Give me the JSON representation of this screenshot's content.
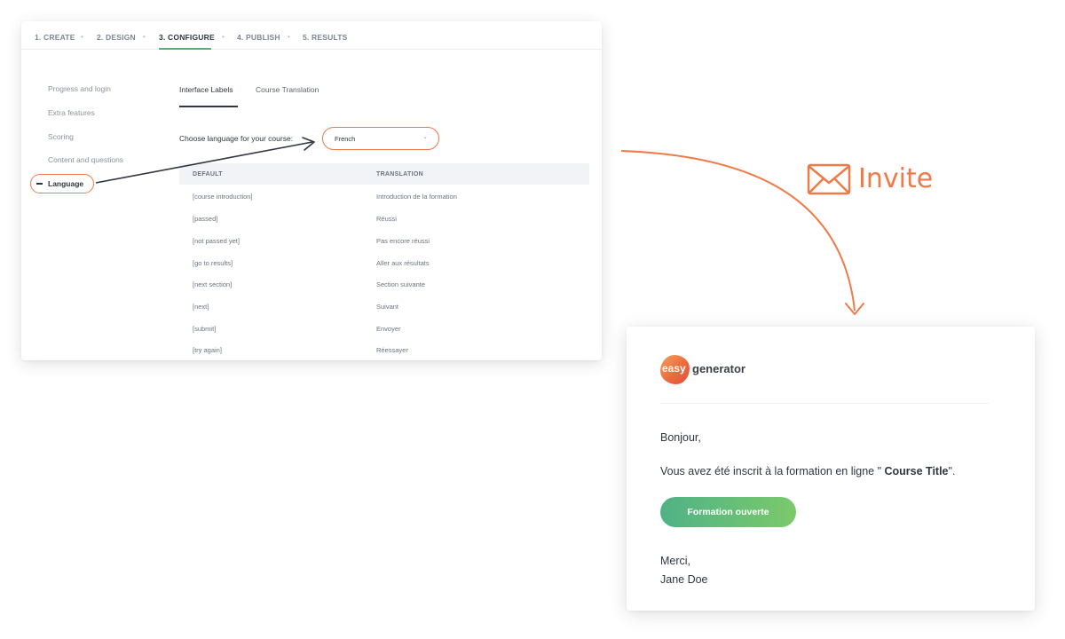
{
  "stepper": {
    "steps": [
      {
        "label": "1. CREATE"
      },
      {
        "label": "2. DESIGN"
      },
      {
        "label": "3. CONFIGURE",
        "active": true
      },
      {
        "label": "4. PUBLISH"
      },
      {
        "label": "5. RESULTS"
      }
    ],
    "separator": "•"
  },
  "sidebar": {
    "items": [
      {
        "label": "Progress and login"
      },
      {
        "label": "Extra features"
      },
      {
        "label": "Scoring"
      },
      {
        "label": "Content and questions"
      },
      {
        "label": "Language",
        "active": true
      }
    ]
  },
  "subtabs": [
    {
      "label": "Interface Labels",
      "active": true
    },
    {
      "label": "Course Translation"
    }
  ],
  "language": {
    "label": "Choose language for your course:",
    "selected": "French"
  },
  "table": {
    "headers": [
      "DEFAULT",
      "TRANSLATION"
    ],
    "rows": [
      [
        "[course introduction]",
        "Introduction de la formation"
      ],
      [
        "[passed]",
        "Réussi"
      ],
      [
        "[not passed yet]",
        "Pas encore réussi"
      ],
      [
        "[go to results]",
        "Aller aux résultats"
      ],
      [
        "[next section]",
        "Section suivante"
      ],
      [
        "[next]",
        "Suivant"
      ],
      [
        "[submit]",
        "Envoyer"
      ],
      [
        "[try again]",
        "Réessayer"
      ]
    ]
  },
  "invite": {
    "label": "Invite",
    "icon": "envelope-icon"
  },
  "email": {
    "logo": {
      "part1": "easy",
      "part2": "generator"
    },
    "greeting": "Bonjour,",
    "body_prefix": "Vous avez été inscrit à la formation en ligne \"",
    "course_title": " Course Title",
    "body_suffix": "\".",
    "cta_label": "Formation ouverte",
    "signoff": "Merci,",
    "signature": "Jane Doe"
  },
  "colors": {
    "accent": "#ef7a48",
    "cta_start": "#4fb287",
    "cta_end": "#7bc96a",
    "active_step": "#55b06a"
  }
}
